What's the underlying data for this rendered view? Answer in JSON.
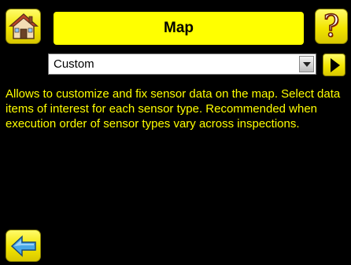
{
  "header": {
    "title": "Map",
    "home_icon": "home-icon",
    "help_icon": "help-icon",
    "help_glyph": "?"
  },
  "selector": {
    "selected_value": "Custom",
    "go_icon": "play-arrow-icon"
  },
  "description": "Allows to customize and fix sensor data on the map. Select data items of interest for each sensor type. Recommended when execution order of sensor types vary across inspections.",
  "footer": {
    "back_icon": "back-arrow-icon"
  },
  "colors": {
    "background": "#000000",
    "accent_yellow": "#ffff00",
    "button_yellow": "#f2e500",
    "text_yellow": "#ffff00"
  }
}
